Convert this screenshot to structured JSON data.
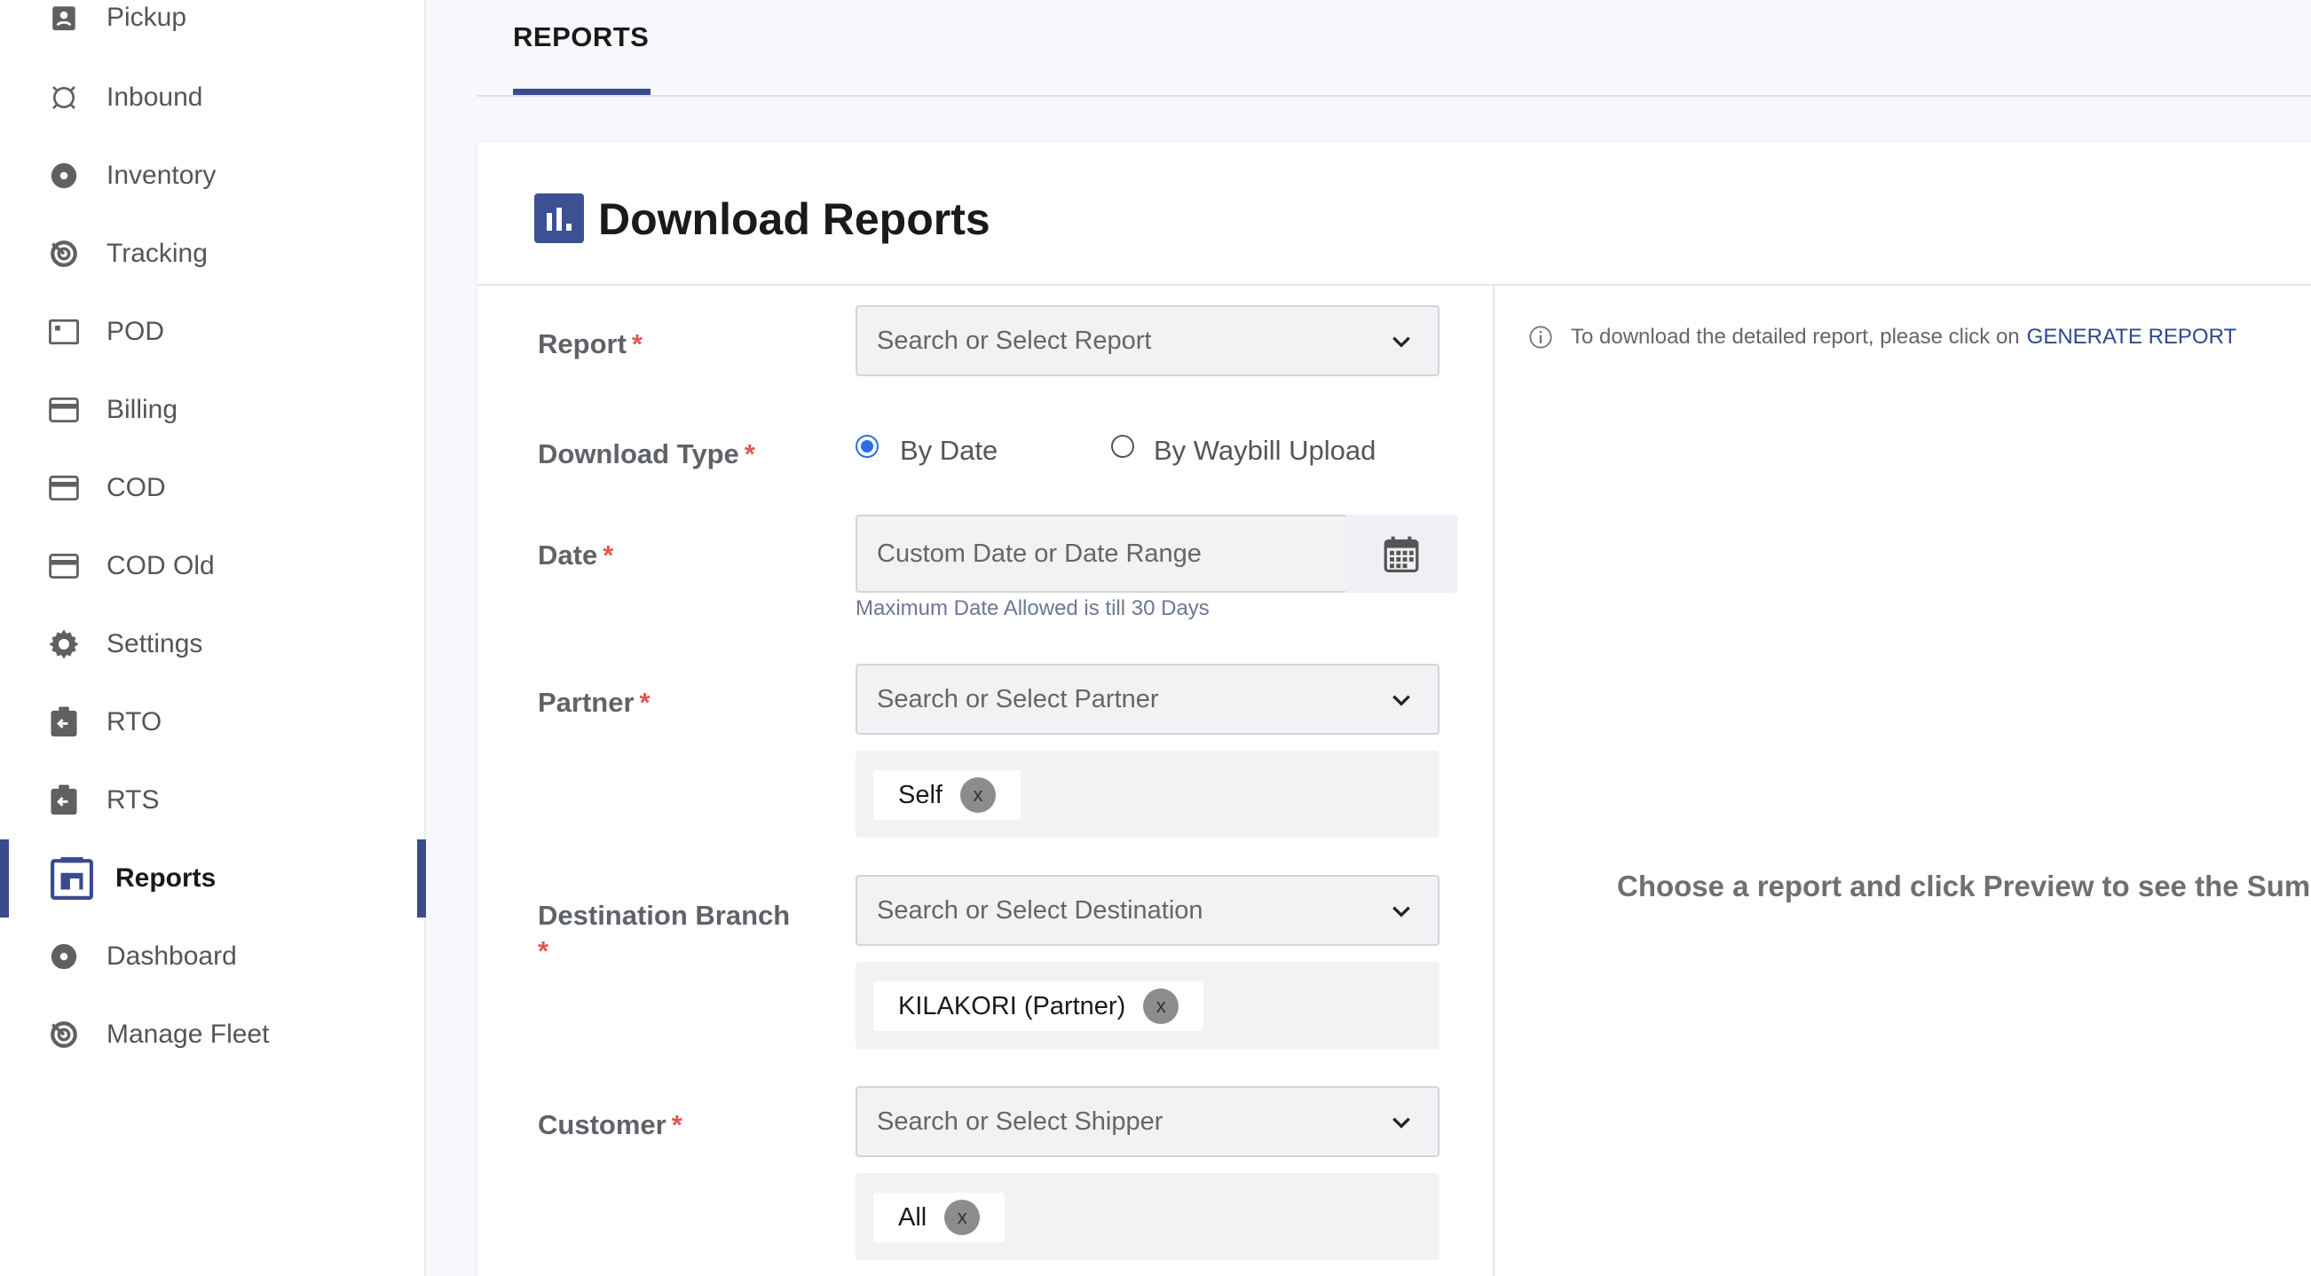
{
  "sidebar": {
    "items": [
      {
        "label": "Pickup",
        "icon": "pickup-icon"
      },
      {
        "label": "Inbound",
        "icon": "inbound-icon"
      },
      {
        "label": "Inventory",
        "icon": "inventory-icon"
      },
      {
        "label": "Tracking",
        "icon": "tracking-icon"
      },
      {
        "label": "POD",
        "icon": "pod-icon"
      },
      {
        "label": "Billing",
        "icon": "billing-icon"
      },
      {
        "label": "COD",
        "icon": "cod-icon"
      },
      {
        "label": "COD Old",
        "icon": "cod-old-icon"
      },
      {
        "label": "Settings",
        "icon": "gear-icon"
      },
      {
        "label": "RTO",
        "icon": "rto-icon"
      },
      {
        "label": "RTS",
        "icon": "rts-icon"
      },
      {
        "label": "Reports",
        "icon": "reports-icon",
        "active": true
      },
      {
        "label": "Dashboard",
        "icon": "dashboard-icon"
      },
      {
        "label": "Manage Fleet",
        "icon": "fleet-icon"
      }
    ]
  },
  "header": {
    "tab": "REPORTS"
  },
  "card": {
    "title": "Download Reports",
    "fields": {
      "report": {
        "label": "Report",
        "required": "*",
        "placeholder": "Search or Select Report"
      },
      "download_type": {
        "label": "Download Type",
        "required": "*",
        "options": [
          "By Date",
          "By Waybill Upload"
        ],
        "selected": "By Date"
      },
      "date": {
        "label": "Date",
        "required": "*",
        "placeholder": "Custom Date or Date Range",
        "hint": "Maximum Date Allowed is till 30 Days"
      },
      "partner": {
        "label": "Partner",
        "required": "*",
        "placeholder": "Search or Select Partner",
        "chip": "Self"
      },
      "destination": {
        "label": "Destination Branch",
        "required": "*",
        "placeholder": "Search or Select Destination",
        "chip": "KILAKORI (Partner)"
      },
      "customer": {
        "label": "Customer",
        "required": "*",
        "placeholder": "Search or Select Shipper",
        "chip": "All"
      }
    },
    "chip_remove": "x",
    "info": {
      "text": "To download the detailed report, please click on",
      "link": "GENERATE REPORT"
    },
    "empty_message": "Choose a report and click Preview to see the Summ"
  },
  "colors": {
    "accent": "#3b4a8c",
    "required": "#e2574c",
    "radio": "#2a6fe8"
  }
}
